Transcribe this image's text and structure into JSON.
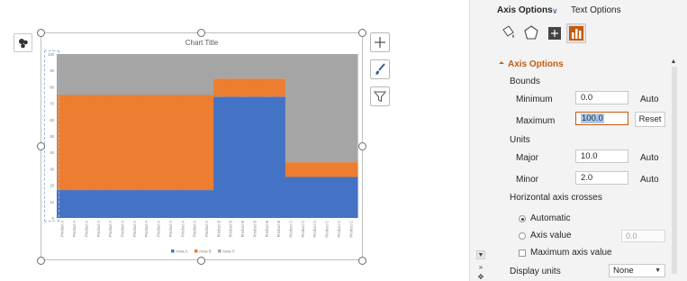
{
  "chart": {
    "title": "Chart Title",
    "colors": {
      "area_a": "#4472c4",
      "area_b": "#ed7d31",
      "area_c": "#a5a5a5",
      "axis_text": "#7f7f7f"
    }
  },
  "chart_data": {
    "type": "area",
    "title": "Chart Title",
    "xlabel": "",
    "ylabel": "",
    "ylim": [
      0,
      100
    ],
    "y_ticks": [
      "0",
      "10",
      "20",
      "30",
      "40",
      "50",
      "60",
      "70",
      "80",
      "90",
      "100"
    ],
    "categories": [
      "Product A",
      "Product A",
      "Product A",
      "Product A",
      "Product A",
      "Product A",
      "Product A",
      "Product A",
      "Product A",
      "Product A",
      "Product A",
      "Product A",
      "Product A",
      "Product B",
      "Product B",
      "Product B",
      "Product B",
      "Product B",
      "Product B",
      "Product C",
      "Product C",
      "Product C",
      "Product C",
      "Product C",
      "Product C"
    ],
    "stacked": true,
    "series": [
      {
        "name": "Area A",
        "values": [
          17,
          17,
          17,
          17,
          17,
          17,
          17,
          17,
          17,
          17,
          17,
          17,
          17,
          74,
          74,
          74,
          74,
          74,
          74,
          25,
          25,
          25,
          25,
          25,
          25
        ]
      },
      {
        "name": "Area B",
        "values": [
          58,
          58,
          58,
          58,
          58,
          58,
          58,
          58,
          58,
          58,
          58,
          58,
          58,
          11,
          11,
          11,
          11,
          11,
          11,
          9,
          9,
          9,
          9,
          9,
          9
        ]
      },
      {
        "name": "Area C",
        "values": [
          25,
          25,
          25,
          25,
          25,
          25,
          25,
          25,
          25,
          25,
          25,
          25,
          25,
          15,
          15,
          15,
          15,
          15,
          15,
          66,
          66,
          66,
          66,
          66,
          66
        ]
      }
    ],
    "grid": false,
    "legend": "bottom"
  },
  "pane": {
    "tab_axis_options": "Axis Options",
    "tab_text_options": "Text Options",
    "section_title": "Axis Options",
    "bounds_label": "Bounds",
    "minimum_label": "Minimum",
    "minimum_value": "0.0",
    "minimum_state": "Auto",
    "maximum_label": "Maximum",
    "maximum_value": "100.0",
    "reset_label": "Reset",
    "units_label": "Units",
    "major_label": "Major",
    "major_value": "10.0",
    "major_state": "Auto",
    "minor_label": "Minor",
    "minor_value": "2.0",
    "minor_state": "Auto",
    "h_axis_crosses_label": "Horizontal axis crosses",
    "automatic_label": "Automatic",
    "axis_value_label": "Axis value",
    "axis_value_field": "0.0",
    "max_axis_value_label": "Maximum axis value",
    "display_units_label": "Display units",
    "display_units_value": "None"
  }
}
